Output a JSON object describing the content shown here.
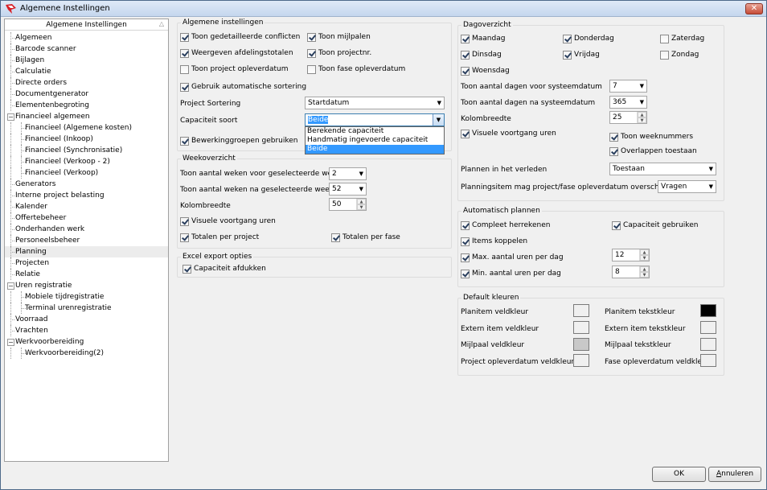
{
  "window": {
    "title": "Algemene Instellingen",
    "close_icon": "close-icon",
    "logo_icon": "app-logo-icon"
  },
  "sidebar": {
    "header": "Algemene Instellingen",
    "items": [
      {
        "label": "Algemeen",
        "level": 0
      },
      {
        "label": "Barcode scanner",
        "level": 0
      },
      {
        "label": "Bijlagen",
        "level": 0
      },
      {
        "label": "Calculatie",
        "level": 0
      },
      {
        "label": "Directe orders",
        "level": 0
      },
      {
        "label": "Documentgenerator",
        "level": 0
      },
      {
        "label": "Elementenbegroting",
        "level": 0
      },
      {
        "label": "Financieel algemeen",
        "level": 0,
        "expanded": true
      },
      {
        "label": "Financieel (Algemene kosten)",
        "level": 1
      },
      {
        "label": "Financieel (Inkoop)",
        "level": 1
      },
      {
        "label": "Financieel (Synchronisatie)",
        "level": 1
      },
      {
        "label": "Financieel (Verkoop - 2)",
        "level": 1
      },
      {
        "label": "Financieel (Verkoop)",
        "level": 1
      },
      {
        "label": "Generators",
        "level": 0
      },
      {
        "label": "Interne project belasting",
        "level": 0
      },
      {
        "label": "Kalender",
        "level": 0
      },
      {
        "label": "Offertebeheer",
        "level": 0
      },
      {
        "label": "Onderhanden werk",
        "level": 0
      },
      {
        "label": "Personeelsbeheer",
        "level": 0
      },
      {
        "label": "Planning",
        "level": 0,
        "selected": true
      },
      {
        "label": "Projecten",
        "level": 0
      },
      {
        "label": "Relatie",
        "level": 0
      },
      {
        "label": "Uren registratie",
        "level": 0,
        "expanded": true
      },
      {
        "label": "Mobiele tijdregistratie",
        "level": 1
      },
      {
        "label": "Terminal urenregistratie",
        "level": 1
      },
      {
        "label": "Voorraad",
        "level": 0
      },
      {
        "label": "Vrachten",
        "level": 0
      },
      {
        "label": "Werkvoorbereiding",
        "level": 0,
        "expanded": true
      },
      {
        "label": "Werkvoorbereiding(2)",
        "level": 1
      }
    ]
  },
  "algemene": {
    "title": "Algemene instellingen",
    "cb_conflicten": "Toon gedetailleerde conflicten",
    "cb_mijlpalen": "Toon mijlpalen",
    "cb_afdeling": "Weergeven afdelingstotalen",
    "cb_projectnr": "Toon projectnr.",
    "cb_project_oplever": "Toon project opleverdatum",
    "cb_fase_oplever": "Toon fase opleverdatum",
    "cb_sortering": "Gebruik automatische sortering",
    "project_sortering_label": "Project Sortering",
    "project_sortering_value": "Startdatum",
    "capaciteit_label": "Capaciteit soort",
    "capaciteit_value": "Beide",
    "capaciteit_options": [
      "Berekende capaciteit",
      "Handmatig ingevoerde capaciteit",
      "Beide"
    ],
    "cb_bewerking": "Bewerkinggroepen gebruiken"
  },
  "week": {
    "title": "Weekoverzicht",
    "voor_label": "Toon aantal weken voor geselecteerde week",
    "voor_value": "2",
    "na_label": "Toon aantal weken na geselecteerde week",
    "na_value": "52",
    "kolom_label": "Kolombreedte",
    "kolom_value": "50",
    "cb_visueel": "Visuele voortgang uren",
    "cb_totalen_project": "Totalen per project",
    "cb_totalen_fase": "Totalen per fase"
  },
  "excel": {
    "title": "Excel export opties",
    "cb_afdukken": "Capaciteit afdukken"
  },
  "dag": {
    "title": "Dagoverzicht",
    "maandag": "Maandag",
    "dinsdag": "Dinsdag",
    "woensdag": "Woensdag",
    "donderdag": "Donderdag",
    "vrijdag": "Vrijdag",
    "zaterdag": "Zaterdag",
    "zondag": "Zondag",
    "voor_label": "Toon aantal dagen voor systeemdatum",
    "voor_value": "7",
    "na_label": "Toon aantal dagen na systeemdatum",
    "na_value": "365",
    "kolom_label": "Kolombreedte",
    "kolom_value": "25",
    "cb_visueel": "Visuele voortgang uren",
    "cb_weeknummers": "Toon weeknummers",
    "cb_overlappen": "Overlappen toestaan",
    "verleden_label": "Plannen in het verleden",
    "verleden_value": "Toestaan",
    "overschrijden_label": "Planningsitem mag project/fase opleverdatum overschrijden",
    "overschrijden_value": "Vragen"
  },
  "auto": {
    "title": "Automatisch plannen",
    "cb_compleet": "Compleet herrekenen",
    "cb_capaciteit": "Capaciteit gebruiken",
    "cb_items": "Items koppelen",
    "max_label": "Max. aantal uren per dag",
    "max_value": "12",
    "min_label": "Min. aantal uren per dag",
    "min_value": "8"
  },
  "kleuren": {
    "title": "Default kleuren",
    "planitem_veld": "Planitem veldkleur",
    "planitem_tekst": "Planitem tekstkleur",
    "extern_veld": "Extern item veldkleur",
    "extern_tekst": "Extern item tekstkleur",
    "mijlpaal_veld": "Mijlpaal veldkleur",
    "mijlpaal_tekst": "Mijlpaal tekstkleur",
    "project_veld": "Project opleverdatum veldkleur",
    "fase_veld": "Fase opleverdatum veldkleur",
    "colors": {
      "planitem_veld": "#f0f0f0",
      "planitem_tekst": "#000000",
      "extern_veld": "#f0f0f0",
      "extern_tekst": "#f0f0f0",
      "mijlpaal_veld": "#c8c8c8",
      "mijlpaal_tekst": "#f0f0f0",
      "project_veld": "#f0f0f0",
      "fase_veld": "#f0f0f0"
    }
  },
  "buttons": {
    "ok": "OK",
    "annuleren_first": "A",
    "annuleren_rest": "nnuleren"
  }
}
